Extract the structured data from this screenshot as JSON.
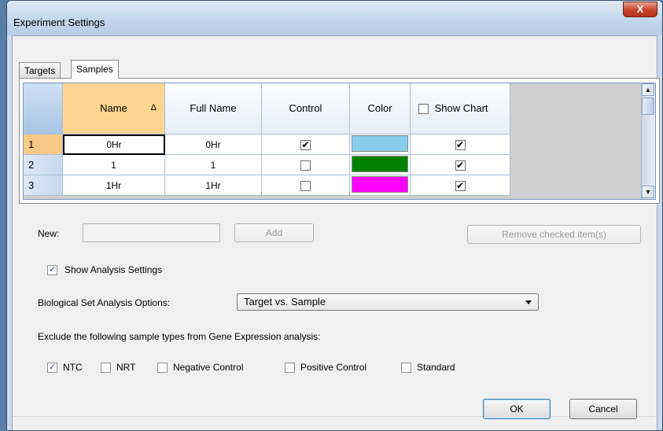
{
  "window": {
    "title": "Experiment Settings",
    "close_glyph": "X"
  },
  "tabs": [
    {
      "label": "Targets"
    },
    {
      "label": "Samples"
    }
  ],
  "grid": {
    "columns": [
      "Name",
      "Full Name",
      "Control",
      "Color",
      "Show Chart"
    ],
    "sort_indicator": "Δ",
    "rows": [
      {
        "num": "1",
        "name": "0Hr",
        "full_name": "0Hr",
        "control": true,
        "color": "#87ceeb",
        "show_chart": true
      },
      {
        "num": "2",
        "name": "1",
        "full_name": "1",
        "control": false,
        "color": "#008000",
        "show_chart": true
      },
      {
        "num": "3",
        "name": "1Hr",
        "full_name": "1Hr",
        "control": false,
        "color": "#ff00ff",
        "show_chart": true
      }
    ]
  },
  "new_sample": {
    "label": "New:",
    "value": "",
    "add_label": "Add",
    "remove_label": "Remove checked item(s)"
  },
  "show_analysis": {
    "label": "Show Analysis Settings",
    "checked": true
  },
  "bio_set": {
    "label": "Biological Set Analysis Options:",
    "selected": "Target vs. Sample"
  },
  "exclude": {
    "label": "Exclude the following sample types from Gene Expression analysis:",
    "options": [
      {
        "label": "NTC",
        "checked": true
      },
      {
        "label": "NRT",
        "checked": false
      },
      {
        "label": "Negative Control",
        "checked": false
      },
      {
        "label": "Positive Control",
        "checked": false
      },
      {
        "label": "Standard",
        "checked": false
      }
    ]
  },
  "footer": {
    "ok_label": "OK",
    "cancel_label": "Cancel"
  },
  "glyphs": {
    "check": "✓",
    "grid_check": "✔"
  }
}
